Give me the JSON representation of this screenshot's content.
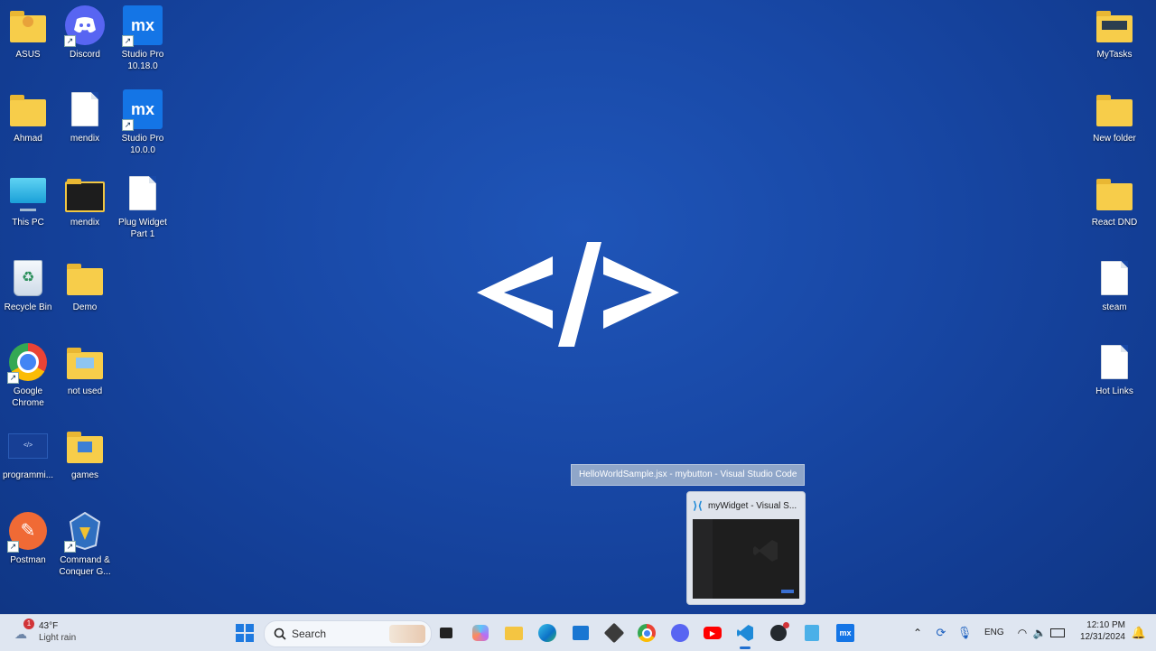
{
  "desktop": {
    "left_icons": [
      {
        "label": "ASUS",
        "icon": "folder-user-icon"
      },
      {
        "label": "Discord",
        "icon": "discord-icon"
      },
      {
        "label": "Studio Pro 10.18.0",
        "icon": "mendix-icon"
      },
      {
        "label": "Ahmad",
        "icon": "folder-icon"
      },
      {
        "label": "mendix",
        "icon": "document-icon"
      },
      {
        "label": "Studio Pro 10.0.0",
        "icon": "mendix-icon"
      },
      {
        "label": "This PC",
        "icon": "monitor-icon"
      },
      {
        "label": "mendix",
        "icon": "folder-icon"
      },
      {
        "label": "Plug Widget Part 1",
        "icon": "document-icon"
      },
      {
        "label": "Recycle Bin",
        "icon": "recycle-bin-icon"
      },
      {
        "label": "Demo",
        "icon": "folder-icon"
      },
      {
        "label": "Google Chrome",
        "icon": "chrome-icon"
      },
      {
        "label": "not used",
        "icon": "folder-icon"
      },
      {
        "label": "programmi...",
        "icon": "code-thumbnail-icon"
      },
      {
        "label": "games",
        "icon": "folder-icon"
      },
      {
        "label": "Postman",
        "icon": "postman-icon"
      },
      {
        "label": "Command & Conquer G...",
        "icon": "game-icon"
      }
    ],
    "right_icons": [
      {
        "label": "MyTasks",
        "icon": "folder-icon"
      },
      {
        "label": "New folder",
        "icon": "folder-icon"
      },
      {
        "label": "React DND",
        "icon": "folder-icon"
      },
      {
        "label": "steam",
        "icon": "document-icon"
      },
      {
        "label": "Hot Links",
        "icon": "document-icon"
      }
    ],
    "wallpaper_symbol": "</>"
  },
  "tooltip": {
    "text": "HelloWorldSample.jsx - mybutton - Visual Studio Code"
  },
  "preview": {
    "title": "myWidget - Visual S..."
  },
  "taskbar": {
    "weather": {
      "badge": "1",
      "temp": "43°F",
      "condition": "Light rain"
    },
    "search_label": "Search",
    "language": "ENG",
    "time": "12:10 PM",
    "date": "12/31/2024"
  },
  "colors": {
    "wallpaper": "#1848a6",
    "taskbar": "#dfe6f1",
    "accent": "#1475e6"
  }
}
